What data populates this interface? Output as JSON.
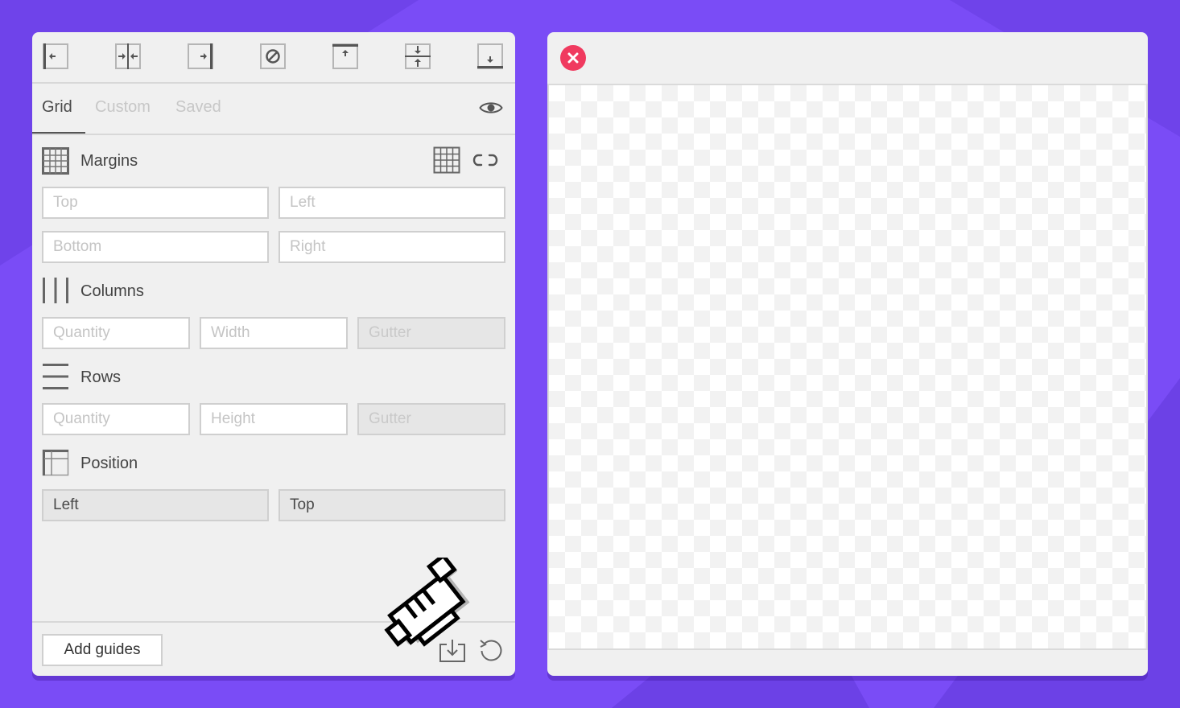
{
  "toolbar": {
    "icons": [
      "align-left-icon",
      "align-center-vertical-icon",
      "align-right-icon",
      "clear-guides-icon",
      "align-top-icon",
      "align-middle-horizontal-icon",
      "align-bottom-icon"
    ]
  },
  "tabs": [
    {
      "label": "Grid",
      "active": true
    },
    {
      "label": "Custom",
      "active": false
    },
    {
      "label": "Saved",
      "active": false
    }
  ],
  "margins": {
    "title": "Margins",
    "top_placeholder": "Top",
    "left_placeholder": "Left",
    "bottom_placeholder": "Bottom",
    "right_placeholder": "Right"
  },
  "columns": {
    "title": "Columns",
    "quantity_placeholder": "Quantity",
    "width_placeholder": "Width",
    "gutter_placeholder": "Gutter"
  },
  "rows": {
    "title": "Rows",
    "quantity_placeholder": "Quantity",
    "height_placeholder": "Height",
    "gutter_placeholder": "Gutter"
  },
  "position": {
    "title": "Position",
    "left_placeholder": "Left",
    "top_placeholder": "Top"
  },
  "footer": {
    "add_button": "Add guides"
  },
  "colors": {
    "background": "#7a4cf6",
    "close": "#f03a5f",
    "panel": "#f0f0f0"
  }
}
